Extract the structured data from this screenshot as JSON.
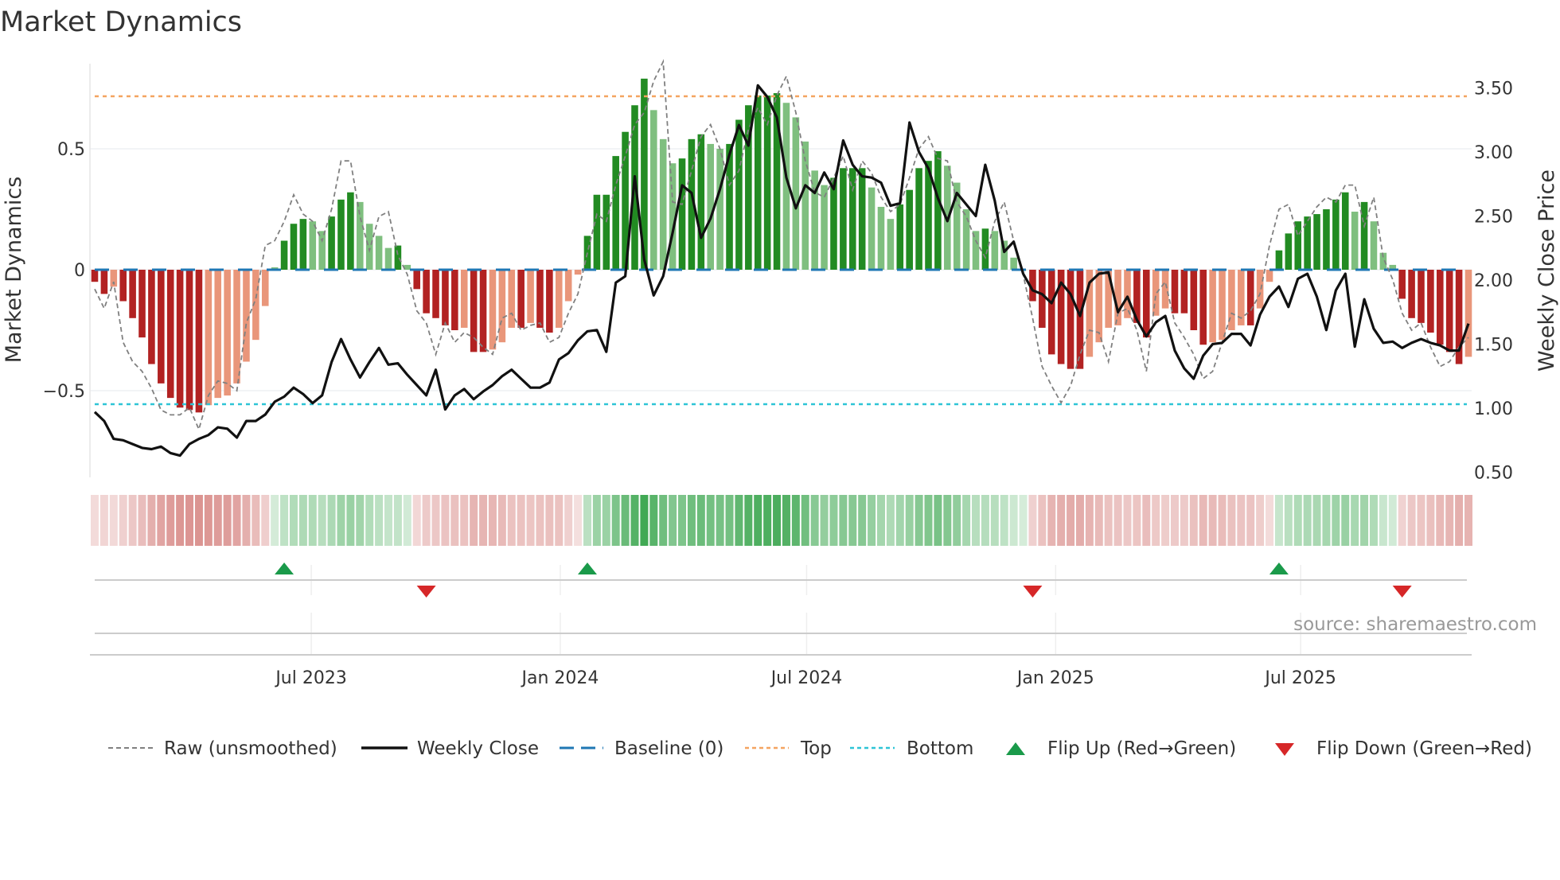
{
  "title": "Market Dynamics",
  "source": "source: sharemaestro.com",
  "colors": {
    "green_strong": "#228b22",
    "green_weak": "#7fbf7f",
    "red_strong": "#b22222",
    "red_weak": "#e9967a",
    "baseline": "#1f77b4",
    "top": "#f4a460",
    "bottom": "#2ec4d6",
    "price": "#111111",
    "raw": "#808080",
    "flip_up": "#1a9a4a",
    "flip_down": "#d62728"
  },
  "chart_data": {
    "type": "bar",
    "title": "Market Dynamics",
    "ylabel": "Market Dynamics",
    "y2label": "Weekly Close Price",
    "ylim": [
      -0.86,
      0.84
    ],
    "y2lim": [
      0.45,
      3.68
    ],
    "yticks": [
      "0.5",
      "0",
      "−0.5"
    ],
    "ytick_values": [
      0.5,
      0,
      -0.5
    ],
    "y2ticks": [
      "3.50",
      "3.00",
      "2.50",
      "2.00",
      "1.50",
      "1.00",
      "0.50"
    ],
    "y2tick_values": [
      3.5,
      3.0,
      2.5,
      2.0,
      1.5,
      1.0,
      0.5
    ],
    "xticks": [
      "Jul 2023",
      "Jan 2024",
      "Jul 2024",
      "Jan 2025",
      "Jul 2025"
    ],
    "xtick_dates": [
      "2023-07-01",
      "2024-01-01",
      "2024-07-01",
      "2025-01-01",
      "2025-07-01"
    ],
    "start_date": "2023-01-22",
    "frequency": "weekly",
    "top_level": 0.717,
    "bottom_level": -0.556,
    "baseline": 0,
    "smoothed": [
      -0.05,
      -0.1,
      -0.07,
      -0.13,
      -0.2,
      -0.28,
      -0.39,
      -0.47,
      -0.53,
      -0.57,
      -0.58,
      -0.59,
      -0.56,
      -0.53,
      -0.52,
      -0.47,
      -0.38,
      -0.29,
      -0.15,
      0.01,
      0.12,
      0.19,
      0.21,
      0.2,
      0.16,
      0.22,
      0.29,
      0.32,
      0.28,
      0.19,
      0.14,
      0.09,
      0.1,
      0.02,
      -0.08,
      -0.18,
      -0.2,
      -0.23,
      -0.25,
      -0.24,
      -0.34,
      -0.34,
      -0.33,
      -0.3,
      -0.24,
      -0.24,
      -0.22,
      -0.24,
      -0.26,
      -0.24,
      -0.13,
      -0.02,
      0.14,
      0.31,
      0.31,
      0.47,
      0.57,
      0.68,
      0.79,
      0.66,
      0.54,
      0.44,
      0.46,
      0.54,
      0.56,
      0.52,
      0.5,
      0.52,
      0.62,
      0.68,
      0.72,
      0.72,
      0.73,
      0.69,
      0.63,
      0.53,
      0.41,
      0.35,
      0.38,
      0.42,
      0.42,
      0.42,
      0.34,
      0.26,
      0.21,
      0.27,
      0.33,
      0.42,
      0.45,
      0.49,
      0.43,
      0.36,
      0.25,
      0.16,
      0.17,
      0.16,
      0.12,
      0.05,
      0.0,
      -0.13,
      -0.24,
      -0.35,
      -0.39,
      -0.41,
      -0.41,
      -0.36,
      -0.3,
      -0.24,
      -0.23,
      -0.2,
      -0.22,
      -0.28,
      -0.19,
      -0.16,
      -0.18,
      -0.18,
      -0.25,
      -0.31,
      -0.3,
      -0.29,
      -0.25,
      -0.23,
      -0.23,
      -0.16,
      -0.05,
      0.08,
      0.15,
      0.2,
      0.22,
      0.23,
      0.25,
      0.29,
      0.32,
      0.24,
      0.28,
      0.2,
      0.07,
      0.02,
      -0.12,
      -0.2,
      -0.22,
      -0.26,
      -0.31,
      -0.34,
      -0.39,
      -0.36
    ],
    "raw": [
      -0.08,
      -0.16,
      -0.05,
      -0.3,
      -0.38,
      -0.42,
      -0.49,
      -0.58,
      -0.6,
      -0.6,
      -0.57,
      -0.66,
      -0.52,
      -0.46,
      -0.47,
      -0.5,
      -0.22,
      -0.12,
      0.1,
      0.12,
      0.2,
      0.31,
      0.23,
      0.2,
      0.12,
      0.25,
      0.45,
      0.45,
      0.22,
      0.08,
      0.22,
      0.24,
      0.06,
      -0.02,
      -0.17,
      -0.22,
      -0.35,
      -0.22,
      -0.3,
      -0.26,
      -0.28,
      -0.32,
      -0.35,
      -0.2,
      -0.18,
      -0.25,
      -0.23,
      -0.22,
      -0.3,
      -0.28,
      -0.18,
      -0.1,
      0.07,
      0.23,
      0.2,
      0.35,
      0.47,
      0.6,
      0.65,
      0.78,
      0.86,
      0.28,
      0.27,
      0.41,
      0.55,
      0.6,
      0.5,
      0.35,
      0.41,
      0.58,
      0.67,
      0.6,
      0.72,
      0.8,
      0.65,
      0.45,
      0.32,
      0.3,
      0.38,
      0.47,
      0.33,
      0.45,
      0.4,
      0.3,
      0.24,
      0.27,
      0.38,
      0.5,
      0.55,
      0.46,
      0.45,
      0.28,
      0.22,
      0.12,
      0.05,
      0.2,
      0.28,
      0.12,
      -0.02,
      -0.2,
      -0.4,
      -0.48,
      -0.55,
      -0.48,
      -0.35,
      -0.25,
      -0.26,
      -0.38,
      -0.18,
      -0.16,
      -0.25,
      -0.42,
      -0.1,
      -0.05,
      -0.22,
      -0.28,
      -0.35,
      -0.45,
      -0.42,
      -0.3,
      -0.18,
      -0.2,
      -0.17,
      -0.1,
      0.1,
      0.25,
      0.27,
      0.14,
      0.2,
      0.26,
      0.3,
      0.28,
      0.35,
      0.35,
      0.18,
      0.3,
      0.05,
      -0.04,
      -0.18,
      -0.25,
      -0.22,
      -0.32,
      -0.4,
      -0.38,
      -0.32,
      -0.28
    ],
    "weekly_close": [
      0.97,
      0.9,
      0.76,
      0.75,
      0.72,
      0.69,
      0.68,
      0.7,
      0.65,
      0.63,
      0.72,
      0.76,
      0.79,
      0.85,
      0.84,
      0.77,
      0.9,
      0.9,
      0.95,
      1.05,
      1.09,
      1.16,
      1.11,
      1.04,
      1.1,
      1.36,
      1.54,
      1.38,
      1.24,
      1.36,
      1.47,
      1.34,
      1.35,
      1.26,
      1.18,
      1.1,
      1.3,
      0.99,
      1.1,
      1.15,
      1.07,
      1.13,
      1.18,
      1.25,
      1.3,
      1.23,
      1.16,
      1.16,
      1.2,
      1.38,
      1.43,
      1.53,
      1.6,
      1.61,
      1.44,
      1.98,
      2.03,
      2.81,
      2.16,
      1.88,
      2.03,
      2.37,
      2.74,
      2.68,
      2.33,
      2.48,
      2.71,
      2.98,
      3.21,
      3.05,
      3.52,
      3.43,
      3.27,
      2.8,
      2.56,
      2.74,
      2.68,
      2.84,
      2.71,
      3.09,
      2.9,
      2.81,
      2.8,
      2.76,
      2.58,
      2.6,
      3.23,
      3.0,
      2.87,
      2.64,
      2.46,
      2.68,
      2.59,
      2.5,
      2.9,
      2.62,
      2.22,
      2.3,
      2.05,
      1.92,
      1.89,
      1.82,
      1.98,
      1.89,
      1.72,
      1.98,
      2.05,
      2.06,
      1.75,
      1.87,
      1.69,
      1.56,
      1.67,
      1.72,
      1.45,
      1.31,
      1.23,
      1.41,
      1.5,
      1.51,
      1.58,
      1.58,
      1.49,
      1.73,
      1.87,
      1.95,
      1.79,
      2.01,
      2.05,
      1.87,
      1.61,
      1.92,
      2.05,
      1.48,
      1.85,
      1.62,
      1.51,
      1.52,
      1.47,
      1.51,
      1.54,
      1.51,
      1.49,
      1.45,
      1.45,
      1.66
    ],
    "flip_up_index": [
      20,
      52,
      125
    ],
    "flip_down_index": [
      35,
      99,
      138
    ],
    "legend": {
      "placement": "bottom",
      "raw": "Raw (unsmoothed)",
      "close": "Weekly Close",
      "baseline": "Baseline (0)",
      "top": "Top",
      "bottom": "Bottom",
      "flip_up": "Flip Up (Red→Green)",
      "flip_down": "Flip Down (Green→Red)"
    }
  }
}
